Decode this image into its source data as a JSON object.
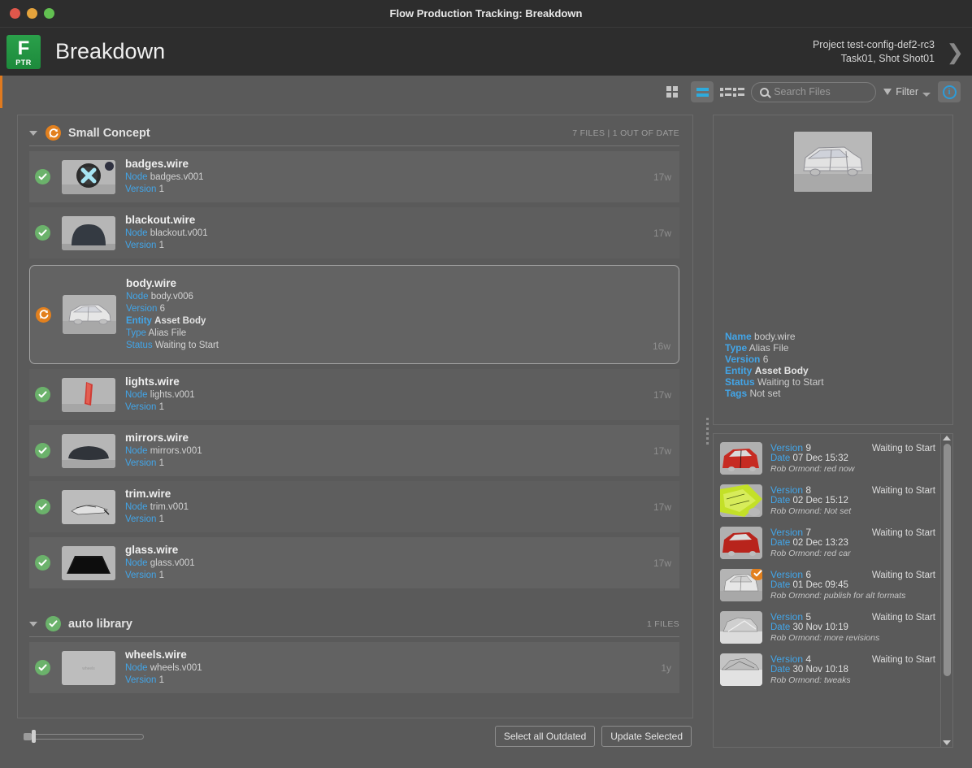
{
  "window": {
    "title": "Flow Production Tracking: Breakdown",
    "traffic_lights": [
      "close",
      "minimize",
      "maximize"
    ]
  },
  "header": {
    "app_name": "Breakdown",
    "logo_letter": "F",
    "logo_sub": "PTR",
    "context_line1": "Project test-config-def2-rc3",
    "context_line2": "Task01, Shot Shot01",
    "expand_arrow": "❯"
  },
  "toolbar": {
    "view_grid": "grid-view",
    "view_list": "list-view",
    "view_detail": "detail-view",
    "search_placeholder": "Search Files",
    "search_value": "",
    "filter_label": "Filter",
    "info_glyph": "i"
  },
  "groups": [
    {
      "name": "Small Concept",
      "status": "out-of-date",
      "meta": "7 FILES | 1 OUT OF DATE",
      "files": [
        {
          "name": "badges.wire",
          "status": "up-to-date",
          "age": "17w",
          "selected": false,
          "thumb": "badge-disc",
          "thumb_badge": true,
          "fields": [
            {
              "key": "Node",
              "value": "badges.v001"
            },
            {
              "key": "Version",
              "value": "1"
            }
          ]
        },
        {
          "name": "blackout.wire",
          "status": "up-to-date",
          "age": "17w",
          "selected": false,
          "thumb": "blackout-dome",
          "thumb_badge": false,
          "fields": [
            {
              "key": "Node",
              "value": "blackout.v001"
            },
            {
              "key": "Version",
              "value": "1"
            }
          ]
        },
        {
          "name": "body.wire",
          "status": "out-of-date",
          "age": "16w",
          "selected": true,
          "thumb": "car-wire",
          "thumb_badge": false,
          "fields": [
            {
              "key": "Node",
              "value": "body.v006"
            },
            {
              "key": "Version",
              "value": "6"
            },
            {
              "key": "Entity",
              "value": "Asset Body",
              "bold": true
            },
            {
              "key": "Type",
              "value": "Alias File"
            },
            {
              "key": "Status",
              "value": "Waiting to Start"
            }
          ]
        },
        {
          "name": "lights.wire",
          "status": "up-to-date",
          "age": "17w",
          "selected": false,
          "thumb": "light-red",
          "thumb_badge": false,
          "fields": [
            {
              "key": "Node",
              "value": "lights.v001"
            },
            {
              "key": "Version",
              "value": "1"
            }
          ]
        },
        {
          "name": "mirrors.wire",
          "status": "up-to-date",
          "age": "17w",
          "selected": false,
          "thumb": "mirror-dark",
          "thumb_badge": false,
          "fields": [
            {
              "key": "Node",
              "value": "mirrors.v001"
            },
            {
              "key": "Version",
              "value": "1"
            }
          ]
        },
        {
          "name": "trim.wire",
          "status": "up-to-date",
          "age": "17w",
          "selected": false,
          "thumb": "trim-wire",
          "thumb_badge": false,
          "fields": [
            {
              "key": "Node",
              "value": "trim.v001"
            },
            {
              "key": "Version",
              "value": "1"
            }
          ]
        },
        {
          "name": "glass.wire",
          "status": "up-to-date",
          "age": "17w",
          "selected": false,
          "thumb": "glass-dark",
          "thumb_badge": false,
          "fields": [
            {
              "key": "Node",
              "value": "glass.v001"
            },
            {
              "key": "Version",
              "value": "1"
            }
          ]
        }
      ]
    },
    {
      "name": "auto library",
      "status": "up-to-date",
      "meta": "1 FILES",
      "files": [
        {
          "name": "wheels.wire",
          "status": "up-to-date",
          "age": "1y",
          "selected": false,
          "thumb": "wheels-plain",
          "thumb_badge": false,
          "fields": [
            {
              "key": "Node",
              "value": "wheels.v001"
            },
            {
              "key": "Version",
              "value": "1"
            }
          ]
        }
      ]
    }
  ],
  "bottom": {
    "slider_value": 7,
    "select_all_outdated": "Select all Outdated",
    "update_selected": "Update Selected"
  },
  "detail": {
    "thumb": "car-wire-large",
    "fields": [
      {
        "key": "Name",
        "value": "body.wire"
      },
      {
        "key": "Type",
        "value": "Alias File"
      },
      {
        "key": "Version",
        "value": "6"
      },
      {
        "key": "Entity",
        "value": "Asset Body",
        "bold": true
      },
      {
        "key": "Status",
        "value": "Waiting to Start"
      },
      {
        "key": "Tags",
        "value": "Not set"
      }
    ]
  },
  "versions": {
    "scroll_thumb_pct": 75,
    "items": [
      {
        "version_label": "Version",
        "version": "9",
        "status": "Waiting to Start",
        "date_label": "Date",
        "date": "07 Dec 15:32",
        "note": "Rob Ormond: red now",
        "thumb": "red-wire",
        "current": false
      },
      {
        "version_label": "Version",
        "version": "8",
        "status": "Waiting to Start",
        "date_label": "Date",
        "date": "02 Dec 15:12",
        "note": "Rob Ormond: Not set",
        "thumb": "green-wire",
        "current": false
      },
      {
        "version_label": "Version",
        "version": "7",
        "status": "Waiting to Start",
        "date_label": "Date",
        "date": "02 Dec 13:23",
        "note": "Rob Ormond: red car",
        "thumb": "red-car",
        "current": false
      },
      {
        "version_label": "Version",
        "version": "6",
        "status": "Waiting to Start",
        "date_label": "Date",
        "date": "01 Dec 09:45",
        "note": "Rob Ormond: publish for alt formats",
        "thumb": "grey-wire",
        "current": true
      },
      {
        "version_label": "Version",
        "version": "5",
        "status": "Waiting to Start",
        "date_label": "Date",
        "date": "30 Nov 10:19",
        "note": "Rob Ormond: more revisions",
        "thumb": "grey-wire2",
        "current": false
      },
      {
        "version_label": "Version",
        "version": "4",
        "status": "Waiting to Start",
        "date_label": "Date",
        "date": "30 Nov 10:18",
        "note": "Rob Ormond: tweaks",
        "thumb": "grey-wire3",
        "current": false
      }
    ]
  },
  "colors": {
    "accent_orange": "#e07a1f",
    "link_blue": "#42a5e8",
    "status_green": "#6bb26b",
    "status_orange": "#e2801e",
    "brand_green": "#2aa04a"
  }
}
